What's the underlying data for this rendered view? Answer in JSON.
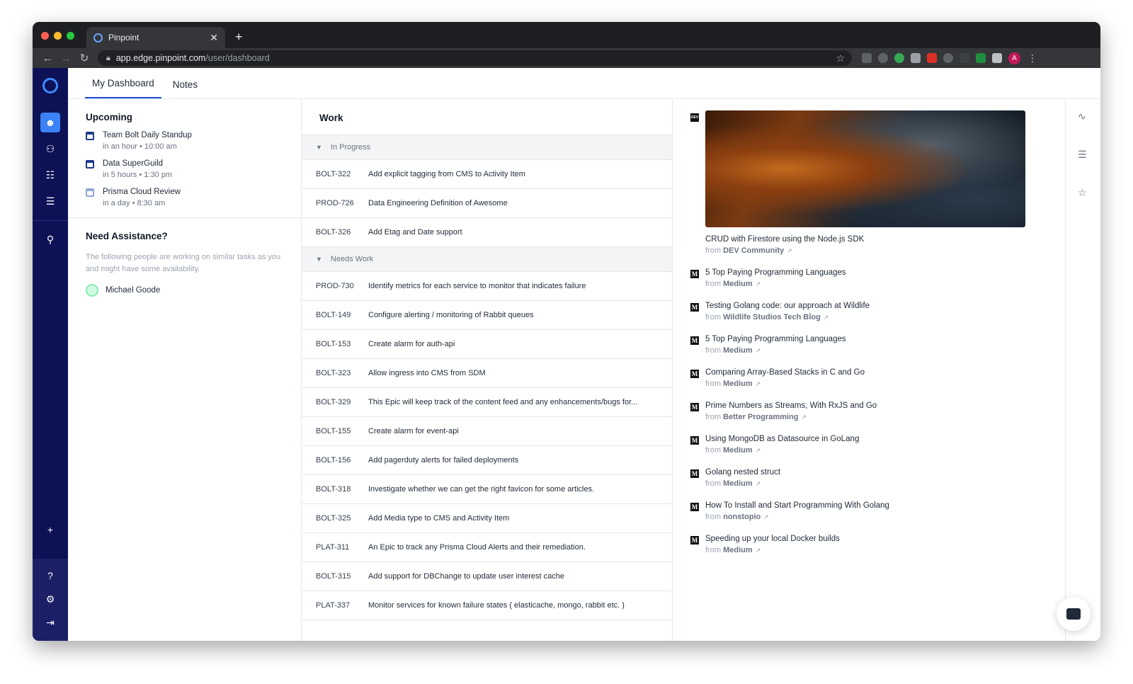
{
  "browser": {
    "tab_title": "Pinpoint",
    "url_host": "app.edge.pinpoint.com",
    "url_path": "/user/dashboard",
    "profile_initial": "A"
  },
  "apptabs": [
    "My Dashboard",
    "Notes"
  ],
  "upcoming": {
    "title": "Upcoming",
    "events": [
      {
        "title": "Team Bolt Daily Standup",
        "when": "in an hour • 10:00 am"
      },
      {
        "title": "Data SuperGuild",
        "when": "in 5 hours • 1:30 pm"
      },
      {
        "title": "Prisma Cloud Review",
        "when": "in a day • 8:30 am"
      }
    ]
  },
  "assistance": {
    "title": "Need Assistance?",
    "description": "The following people are working on similar tasks as you and might have some availability.",
    "people": [
      "Michael Goode"
    ]
  },
  "work": {
    "title": "Work",
    "groups": [
      {
        "name": "In Progress",
        "items": [
          {
            "key": "BOLT-322",
            "summary": "Add explicit tagging from CMS to Activity Item"
          },
          {
            "key": "PROD-726",
            "summary": "Data Engineering Definition of Awesome"
          },
          {
            "key": "BOLT-326",
            "summary": "Add Etag and Date support"
          }
        ]
      },
      {
        "name": "Needs Work",
        "items": [
          {
            "key": "PROD-730",
            "summary": "Identify metrics for each service to monitor that indicates failure"
          },
          {
            "key": "BOLT-149",
            "summary": "Configure alerting / monitoring of Rabbit queues"
          },
          {
            "key": "BOLT-153",
            "summary": "Create alarm for auth-api"
          },
          {
            "key": "BOLT-323",
            "summary": "Allow ingress into CMS from SDM"
          },
          {
            "key": "BOLT-329",
            "summary": "This Epic will keep track of the content feed and any enhancements/bugs for..."
          },
          {
            "key": "BOLT-155",
            "summary": "Create alarm for event-api"
          },
          {
            "key": "BOLT-156",
            "summary": "Add pagerduty alerts for failed deployments"
          },
          {
            "key": "BOLT-318",
            "summary": "Investigate whether we can get the right favicon for some articles."
          },
          {
            "key": "BOLT-325",
            "summary": "Add Media type to CMS and Activity Item"
          },
          {
            "key": "PLAT-311",
            "summary": "An Epic to track any Prisma Cloud Alerts and their remediation."
          },
          {
            "key": "BOLT-315",
            "summary": "Add support for DBChange to update user interest cache"
          },
          {
            "key": "PLAT-337",
            "summary": "Monitor services for known failure states ( elasticache, mongo, rabbit etc. )"
          }
        ]
      }
    ]
  },
  "feed": {
    "from_label": "from",
    "dev_badge": "DEV",
    "medium_badge": "M",
    "articles": [
      {
        "title": "CRUD with Firestore using the Node.js SDK",
        "source": "DEV Community",
        "badge": "dev"
      },
      {
        "title": "5 Top Paying Programming Languages",
        "source": "Medium",
        "badge": "medium"
      },
      {
        "title": "Testing Golang code: our approach at Wildlife",
        "source": "Wildlife Studios Tech Blog",
        "badge": "medium"
      },
      {
        "title": "5 Top Paying Programming Languages",
        "source": "Medium",
        "badge": "medium"
      },
      {
        "title": "Comparing Array-Based Stacks in C and Go",
        "source": "Medium",
        "badge": "medium"
      },
      {
        "title": "Prime Numbers as Streams, With RxJS and Go",
        "source": "Better Programming",
        "badge": "medium"
      },
      {
        "title": "Using MongoDB as Datasource in GoLang",
        "source": "Medium",
        "badge": "medium"
      },
      {
        "title": "Golang nested struct",
        "source": "Medium",
        "badge": "medium"
      },
      {
        "title": "How To Install and Start Programming With Golang",
        "source": "nonstopio",
        "badge": "medium"
      },
      {
        "title": "Speeding up your local Docker builds",
        "source": "Medium",
        "badge": "medium"
      }
    ]
  }
}
